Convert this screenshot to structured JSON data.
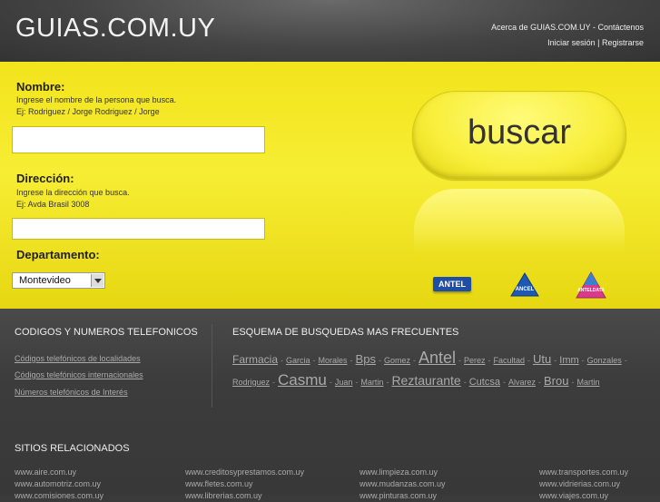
{
  "header": {
    "logo": "GUIAS.COM.UY",
    "links_line1": "Acerca de GUIAS.COM.UY - Contáctenos",
    "links_line2": "Iniciar sesión | Registrarse"
  },
  "form": {
    "nombre_label": "Nombre:",
    "nombre_help1": "Ingrese el nombre de la persona que busca.",
    "nombre_help2": "Ej: Rodriguez / Jorge Rodriguez / Jorge",
    "nombre_value": "",
    "direccion_label": "Dirección:",
    "direccion_help1": "Ingrese la dirección que busca.",
    "direccion_help2": "Ej: Avda Brasil 3008",
    "direccion_value": "",
    "departamento_label": "Departamento:",
    "departamento_selected": "Montevideo",
    "search_button": "buscar"
  },
  "logos": {
    "antel": "ANTEL",
    "antel2": "ANCEL",
    "antel3": "ANTELDATA"
  },
  "codigos": {
    "title": "CODIGOS Y NUMEROS TELEFONICOS",
    "links": [
      "Códigos telefónicos de localidades",
      "Códigos telefónicos internacionales",
      "Números telefónicos de Interés"
    ]
  },
  "esquema": {
    "title": "ESQUEMA DE BUSQUEDAS MAS FRECUENTES",
    "terms": [
      {
        "text": "Farmacia",
        "size": 12
      },
      {
        "text": "Garcia",
        "size": 9
      },
      {
        "text": "Morales",
        "size": 9
      },
      {
        "text": "Bps",
        "size": 13
      },
      {
        "text": "Gomez",
        "size": 9
      },
      {
        "text": "Antel",
        "size": 18
      },
      {
        "text": "Perez",
        "size": 9
      },
      {
        "text": "Facultad",
        "size": 9
      },
      {
        "text": "Utu",
        "size": 13
      },
      {
        "text": "Imm",
        "size": 11
      },
      {
        "text": "Gonzales",
        "size": 9
      },
      {
        "text": "Rodriguez",
        "size": 9
      },
      {
        "text": "Casmu",
        "size": 17
      },
      {
        "text": "Juan",
        "size": 9
      },
      {
        "text": "Martin",
        "size": 9
      },
      {
        "text": "Reztaurante",
        "size": 14
      },
      {
        "text": "Cutcsa",
        "size": 11
      },
      {
        "text": "Alvarez",
        "size": 9
      },
      {
        "text": "Brou",
        "size": 13
      },
      {
        "text": "Martin",
        "size": 9
      }
    ]
  },
  "sitios": {
    "title": "SITIOS RELACIONADOS",
    "col1": [
      "www.aire.com.uy",
      "www.automotriz.com.uy",
      "www.comisiones.com.uy"
    ],
    "col2": [
      "www.creditosyprestamos.com.uy",
      "www.fletes.com.uy",
      "www.librerias.com.uy"
    ],
    "col3": [
      "www.limpieza.com.uy",
      "www.mudanzas.com.uy",
      "www.pinturas.com.uy"
    ],
    "col4": [
      "www.transportes.com.uy",
      "www.vidrierias.com.uy",
      "www.viajes.com.uy"
    ]
  }
}
